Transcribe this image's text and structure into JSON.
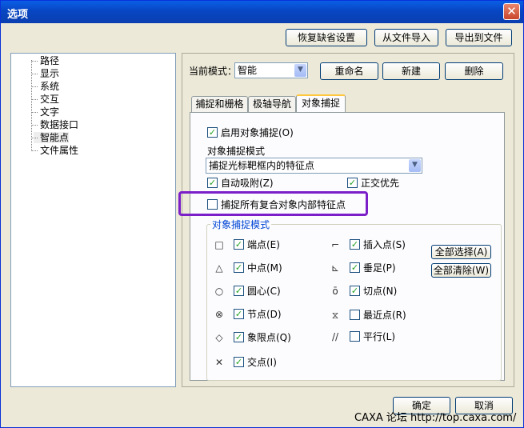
{
  "window": {
    "title": "选项"
  },
  "top_buttons": {
    "restore": "恢复缺省设置",
    "import": "从文件导入",
    "export": "导出到文件"
  },
  "tree": {
    "items": [
      "路径",
      "显示",
      "系统",
      "交互",
      "文字",
      "数据接口",
      "智能点",
      "文件属性"
    ],
    "selected": "智能点"
  },
  "mode": {
    "label": "当前模式：",
    "value": "智能",
    "rename": "重命名",
    "new": "新建",
    "delete": "删除"
  },
  "tabs": [
    "捕捉和栅格",
    "极轴导航",
    "对象捕捉"
  ],
  "active_tab": "对象捕捉",
  "snap": {
    "enable_label": "启用对象捕捉(O)",
    "enable_checked": true,
    "mode_label": "对象捕捉模式",
    "mode_value": "捕捉光标靶框内的特征点",
    "auto_adsorb_label": "自动吸附(Z)",
    "auto_adsorb_checked": true,
    "ortho_priority_label": "正交优先",
    "ortho_priority_checked": true,
    "all_composite_label": "捕捉所有复合对象内部特征点",
    "all_composite_checked": false
  },
  "group": {
    "title": "对象捕捉模式",
    "select_all": "全部选择(A)",
    "clear_all": "全部清除(W)",
    "left": [
      {
        "symbol": "□",
        "icon": "endpoint-icon",
        "label": "端点(E)",
        "checked": true
      },
      {
        "symbol": "△",
        "icon": "midpoint-icon",
        "label": "中点(M)",
        "checked": true
      },
      {
        "symbol": "○",
        "icon": "center-icon",
        "label": "圆心(C)",
        "checked": true
      },
      {
        "symbol": "⊗",
        "icon": "node-icon",
        "label": "节点(D)",
        "checked": true
      },
      {
        "symbol": "◇",
        "icon": "quadrant-icon",
        "label": "象限点(Q)",
        "checked": true
      },
      {
        "symbol": "✕",
        "icon": "intersection-icon",
        "label": "交点(I)",
        "checked": true
      }
    ],
    "right": [
      {
        "symbol": "⌐",
        "icon": "insert-icon",
        "label": "插入点(S)",
        "checked": true
      },
      {
        "symbol": "⊾",
        "icon": "perpendicular-icon",
        "label": "垂足(P)",
        "checked": true
      },
      {
        "symbol": "ō",
        "icon": "tangent-icon",
        "label": "切点(N)",
        "checked": true
      },
      {
        "symbol": "⧖",
        "icon": "nearest-icon",
        "label": "最近点(R)",
        "checked": false
      },
      {
        "symbol": "//",
        "icon": "parallel-icon",
        "label": "平行(L)",
        "checked": false
      }
    ]
  },
  "bottom": {
    "ok": "确定",
    "cancel": "取消"
  },
  "watermark": "CAXA 论坛 http://top.caxa.com/",
  "colors": {
    "title_bar": "#0a5ee6",
    "highlight": "#7b1fc9",
    "group_title": "#0046d5"
  }
}
